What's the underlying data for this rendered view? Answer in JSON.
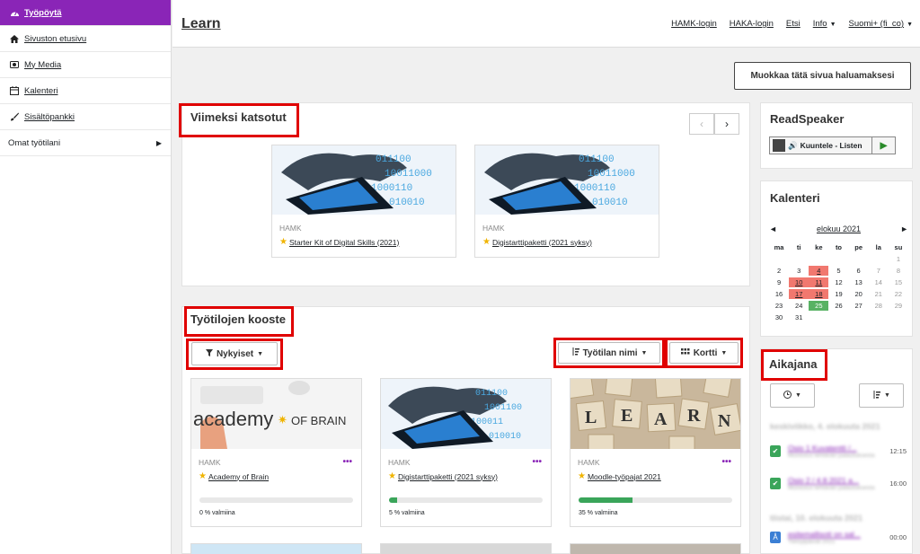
{
  "sidebar": {
    "items": [
      {
        "label": "Työpöytä",
        "icon": "dashboard-icon",
        "active": true
      },
      {
        "label": "Sivuston etusivu",
        "icon": "home-icon"
      },
      {
        "label": "My Media",
        "icon": "media-icon"
      },
      {
        "label": "Kalenteri",
        "icon": "calendar-icon"
      },
      {
        "label": "Sisältöpankki",
        "icon": "brush-icon"
      },
      {
        "label": "Omat työtilani",
        "icon": "chevron-right-icon"
      }
    ]
  },
  "header": {
    "brand": "Learn",
    "links": [
      "HAMK-login",
      "HAKA-login",
      "Etsi",
      "Info",
      "Suomi+ (fi_co)"
    ]
  },
  "edit_button": "Muokkaa tätä sivua haluamaksesi",
  "recent": {
    "title": "Viimeksi katsotut",
    "items": [
      {
        "org": "HAMK",
        "title": "Starter Kit of Digital Skills (2021)"
      },
      {
        "org": "HAMK",
        "title": "Digistarttipaketti (2021 syksy)"
      }
    ]
  },
  "overview": {
    "title": "Työtilojen kooste",
    "filter_label": "Nykyiset",
    "sort_label": "Työtilan nimi",
    "view_label": "Kortti",
    "courses": [
      {
        "org": "HAMK",
        "title": "Academy of Brain",
        "progress": 0,
        "progress_text": "0 % valmiina",
        "image_text_left": "academy",
        "image_text_right": "OF BRAIN"
      },
      {
        "org": "HAMK",
        "title": "Digistarttipaketti (2021 syksy)",
        "progress": 5,
        "progress_text": "5 % valmiina"
      },
      {
        "org": "HAMK",
        "title": "Moodle-työpajat 2021",
        "progress": 35,
        "progress_text": "35 % valmiina",
        "tile_letters": [
          "L",
          "E",
          "A",
          "R",
          "N"
        ]
      }
    ]
  },
  "readspeaker": {
    "title": "ReadSpeaker",
    "button_label": "Kuuntele - Listen"
  },
  "calendar": {
    "title": "Kalenteri",
    "month": "elokuu 2021",
    "prev": "◄",
    "next": "►",
    "day_names": [
      "ma",
      "ti",
      "ke",
      "to",
      "pe",
      "la",
      "su"
    ],
    "weeks": [
      [
        "",
        "",
        "",
        "",
        "",
        "",
        "1"
      ],
      [
        "2",
        "3",
        "4",
        "5",
        "6",
        "7",
        "8"
      ],
      [
        "9",
        "10",
        "11",
        "12",
        "13",
        "14",
        "15"
      ],
      [
        "16",
        "17",
        "18",
        "19",
        "20",
        "21",
        "22"
      ],
      [
        "23",
        "24",
        "25",
        "26",
        "27",
        "28",
        "29"
      ],
      [
        "30",
        "31",
        "",
        "",
        "",
        "",
        ""
      ]
    ],
    "event_days": [
      "4",
      "10",
      "11",
      "17",
      "18"
    ],
    "today": "25"
  },
  "timeline": {
    "title": "Aikajana",
    "groups": [
      {
        "date": "keskiviikko, 4. elokuuta 2021",
        "items": [
          {
            "title": "Osio 1 Kuvatentti /...",
            "sub": "Muistutus tehtävän palautuksesta",
            "time": "12:15",
            "color": "#3aa55a",
            "icon": "check-icon"
          },
          {
            "title": "Osio 2 / 4.8.2021 a...",
            "sub": "Muistutus tehtävän palautuksesta",
            "time": "16:00",
            "color": "#3aa55a",
            "icon": "check-icon"
          }
        ]
      },
      {
        "date": "tiistai, 10. elokuuta 2021",
        "items": [
          {
            "title": "esitemallisoti on sal...",
            "sub": "Tietoylpäivät 2021",
            "time": "00:00",
            "color": "#3b7fd4",
            "icon": "quiz-icon"
          }
        ]
      }
    ]
  },
  "colors": {
    "accent": "#8a25b7",
    "highlight": "#e00000",
    "progress": "#3aa55a",
    "event": "#f1786f",
    "today": "#58b263"
  }
}
